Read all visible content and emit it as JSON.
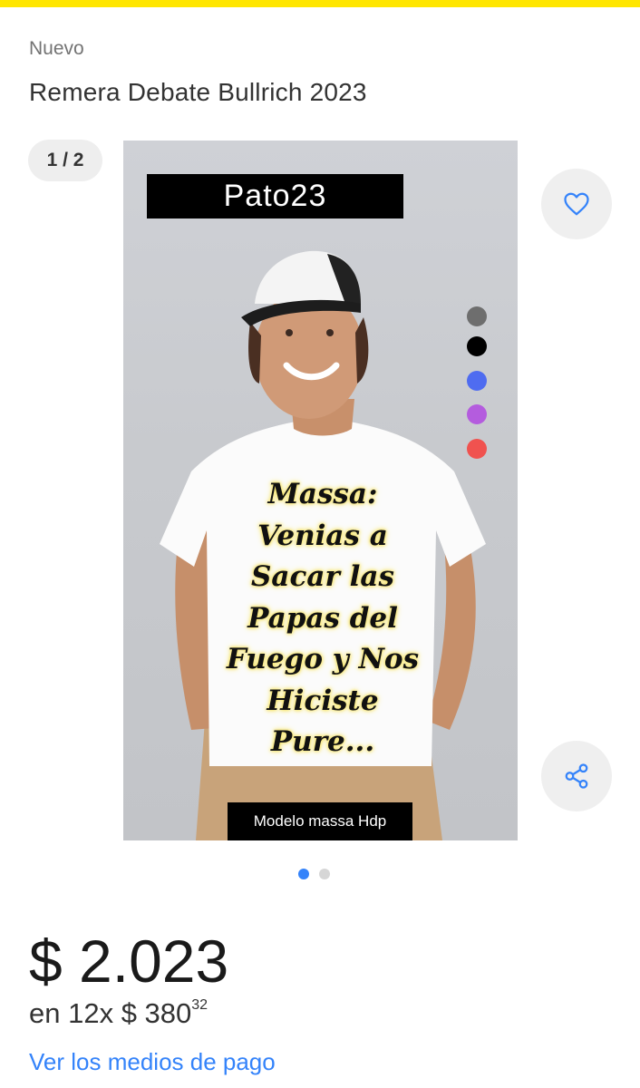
{
  "header": {
    "accent_color": "#ffe600"
  },
  "product": {
    "condition": "Nuevo",
    "title": "Remera Debate Bullrich 2023"
  },
  "gallery": {
    "counter": "1 / 2",
    "brand_label": "Pato23",
    "model_label": "Modelo massa Hdp",
    "shirt_text_lines": [
      "Massa:",
      "Venias a",
      "Sacar las",
      "Papas del",
      "Fuego y Nos",
      "Hiciste",
      "Pure..."
    ],
    "color_swatches": [
      "#6e6e6e",
      "#000000",
      "#4f6cf0",
      "#b45cde",
      "#f0524f"
    ],
    "favorite_icon": "heart-icon",
    "share_icon": "share-icon",
    "pagination": {
      "total": 2,
      "active": 1
    }
  },
  "pricing": {
    "price": "$ 2.023",
    "installments_prefix": "en 12x $ 380",
    "installments_cents": "32",
    "payment_link": "Ver los medios de pago"
  }
}
